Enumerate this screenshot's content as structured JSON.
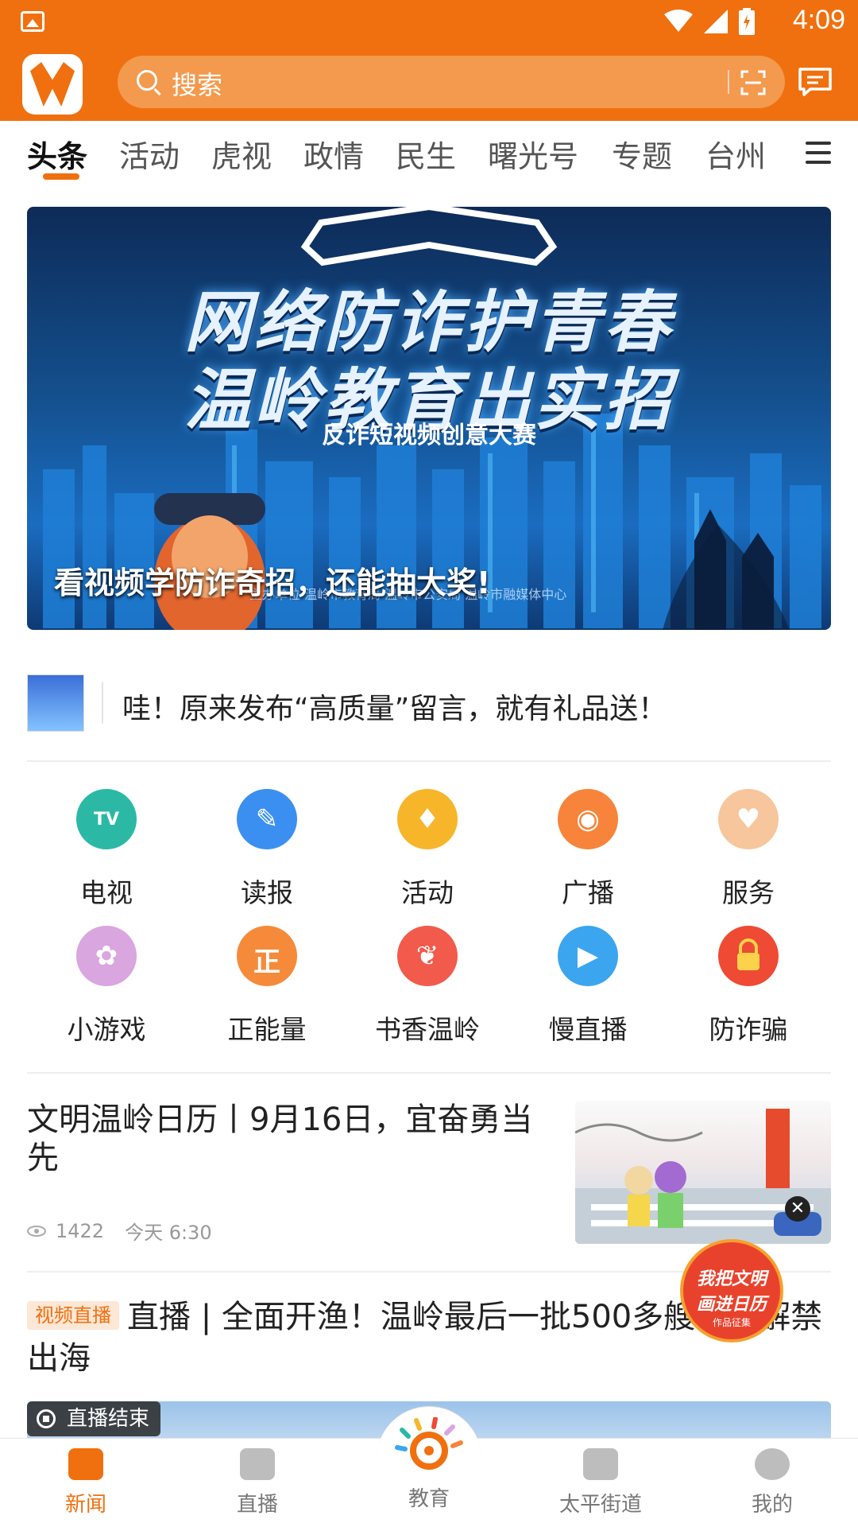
{
  "status_bar": {
    "time": "4:09"
  },
  "header": {
    "search_placeholder": "搜索"
  },
  "tabs": [
    "头条",
    "活动",
    "虎视",
    "政情",
    "民生",
    "曙光号",
    "专题",
    "台州"
  ],
  "active_tab_index": 0,
  "banner": {
    "title_line1": "网络防诈护青春",
    "title_line2": "温岭教育出实招",
    "subtitle": "反诈短视频创意大赛",
    "caption": "看视频学防诈奇招，还能抽大奖!",
    "credit": "主办单位 温岭市教育局 温岭市公安局 温岭市融媒体中心"
  },
  "notice": {
    "text": "哇！原来发布“高质量”留言，就有礼品送！"
  },
  "services": [
    {
      "label": "电视",
      "icon": "tv-icon",
      "color": "#2bb9a6",
      "glyph": "TV"
    },
    {
      "label": "读报",
      "icon": "newspaper-icon",
      "color": "#3b8ff0",
      "glyph": "✎"
    },
    {
      "label": "活动",
      "icon": "activity-icon",
      "color": "#f7b52a",
      "glyph": "♦"
    },
    {
      "label": "广播",
      "icon": "radio-icon",
      "color": "#f7843a",
      "glyph": "◉"
    },
    {
      "label": "服务",
      "icon": "service-icon",
      "color": "#f7c69c",
      "glyph": "♥"
    },
    {
      "label": "小游戏",
      "icon": "game-icon",
      "color": "#d9a6e0",
      "glyph": "✿"
    },
    {
      "label": "正能量",
      "icon": "positive-energy-icon",
      "color": "#f58b3a",
      "glyph": "正"
    },
    {
      "label": "书香温岭",
      "icon": "book-icon",
      "color": "#f25a4c",
      "glyph": "❦"
    },
    {
      "label": "慢直播",
      "icon": "live-camera-icon",
      "color": "#3ba6ef",
      "glyph": "▶"
    },
    {
      "label": "防诈骗",
      "icon": "anti-fraud-icon",
      "color": "#ef4a34",
      "glyph": "🔒"
    }
  ],
  "news1": {
    "title": "文明温岭日历丨9月16日，宜奋勇当先",
    "views": "1422",
    "time": "今天 6:30"
  },
  "float_badge": {
    "line1": "我把文明",
    "line2": "画进日历",
    "line3": "作品征集"
  },
  "news2": {
    "tag": "视频直播",
    "title": "直播 | 全面开渔！温岭最后一批500多艘渔船解禁出海",
    "live_status": "直播结束"
  },
  "bottom_nav": [
    {
      "label": "新闻",
      "icon": "news-icon"
    },
    {
      "label": "直播",
      "icon": "tv-live-icon"
    },
    {
      "label": "教育",
      "icon": "education-icon"
    },
    {
      "label": "太平街道",
      "icon": "street-icon"
    },
    {
      "label": "我的",
      "icon": "profile-icon"
    }
  ],
  "colors": {
    "brand": "#f0700f",
    "active_nav": "#f0700f"
  }
}
